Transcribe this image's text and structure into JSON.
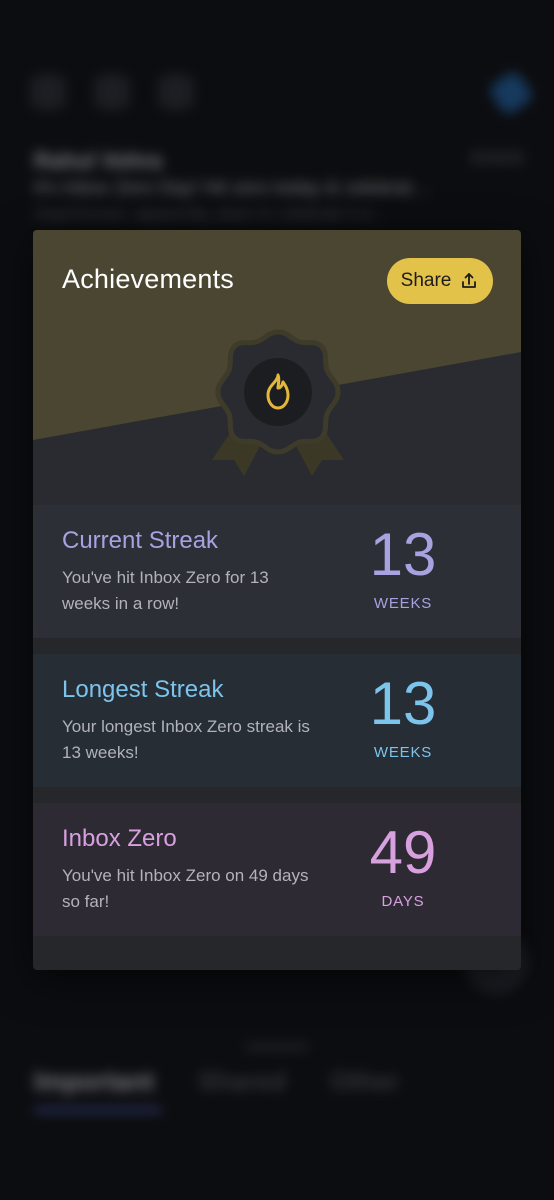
{
  "background": {
    "sender": "Rahul Vohra",
    "date": "5/24/22",
    "subject": "It's Inbox Zero Day! Hit zero today & celebrat…",
    "preview": "Superhuman, apparently, plans to celebrate it w…",
    "tabs": [
      {
        "label": "Important",
        "active": true
      },
      {
        "label": "Shared",
        "active": false
      },
      {
        "label": "Other",
        "active": false
      }
    ]
  },
  "modal": {
    "title": "Achievements",
    "share_label": "Share",
    "badge_icon": "flame-icon",
    "accent_gold": "#e3c24a",
    "stats": [
      {
        "title": "Current Streak",
        "description": "You've hit Inbox Zero for 13 weeks in a row!",
        "value": "13",
        "unit": "WEEKS",
        "color": "#a8a2e0"
      },
      {
        "title": "Longest Streak",
        "description": "Your longest Inbox Zero streak is 13 weeks!",
        "value": "13",
        "unit": "WEEKS",
        "color": "#7cc4ec"
      },
      {
        "title": "Inbox Zero",
        "description": "You've hit Inbox Zero on 49 days so far!",
        "value": "49",
        "unit": "DAYS",
        "color": "#d7a0de"
      }
    ]
  }
}
